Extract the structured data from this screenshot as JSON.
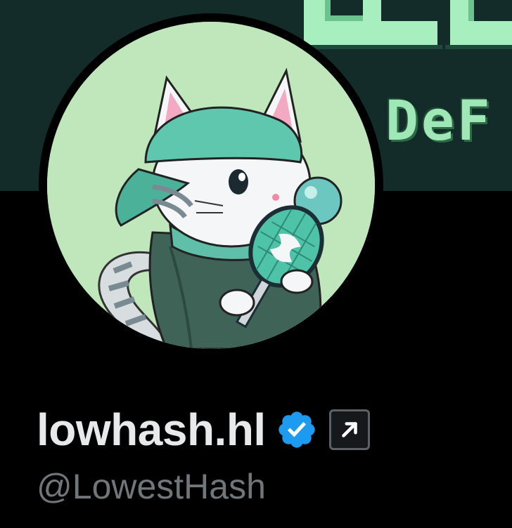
{
  "banner": {
    "text": "DeF",
    "icon": "pixel-art-banner",
    "background_color": "#132b29",
    "text_color": "#9fe7b6"
  },
  "profile": {
    "avatar_icon": "cat-avatar-with-tennis-racket",
    "display_name": "lowhash.hl",
    "verified_icon": "verified-badge-icon",
    "affiliate_icon": "external-link-arrow-icon",
    "handle": "@LowestHash"
  },
  "colors": {
    "page_background": "#000000",
    "name_color": "#e7e9ea",
    "handle_color": "#71767b",
    "verified_color": "#1d9bf0",
    "avatar_background": "#bfe7bb"
  }
}
